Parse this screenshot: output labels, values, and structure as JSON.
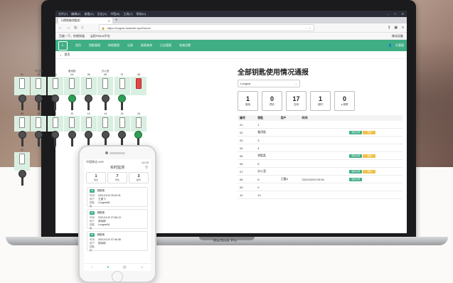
{
  "browser": {
    "menu": [
      "文件(F)",
      "编辑(E)",
      "查看(V)",
      "历史(S)",
      "书签(B)",
      "工具(T)",
      "帮助(H)"
    ],
    "tab_title": "万德智能钥匙柜",
    "url": "https://longest.landwell.vip/#/home",
    "bookmarks": [
      "百度一下，你就知道",
      "云柜PMOA平台"
    ],
    "bookmarks_right": "移动设备"
  },
  "app": {
    "nav": [
      "首页",
      "钥匙管理",
      "授权管理",
      "记录",
      "报表查询",
      "日志管理",
      "系统设置"
    ],
    "user": "天管理",
    "breadcrumb": "首页"
  },
  "keys": {
    "row1_labels": [
      "",
      "车位匙",
      "",
      "备用匙",
      "",
      "办公室",
      ""
    ],
    "row1": [
      {
        "n": "01",
        "k": "dark"
      },
      {
        "n": "02",
        "k": "dark"
      },
      {
        "n": "03",
        "k": "dark"
      },
      {
        "n": "04",
        "k": "green"
      },
      {
        "n": "05",
        "k": "dark"
      },
      {
        "n": "06",
        "k": "dark"
      },
      {
        "n": "07",
        "k": "green"
      },
      {
        "n": "08",
        "k": "none"
      }
    ],
    "row2": [
      {
        "n": "09",
        "k": "dark"
      },
      {
        "n": "10",
        "k": "dark"
      },
      {
        "n": "11",
        "k": "dark"
      },
      {
        "n": "12",
        "k": "dark"
      },
      {
        "n": "13",
        "k": "dark"
      },
      {
        "n": "14",
        "k": "dark"
      },
      {
        "n": "15",
        "k": "dark"
      },
      {
        "n": "16",
        "k": "green"
      }
    ],
    "row3": [
      {
        "n": "17",
        "k": "dark"
      }
    ]
  },
  "panel": {
    "title": "全部钥匙使用情况通报",
    "select": "Longest",
    "stats": [
      {
        "v": "1",
        "l": "借用"
      },
      {
        "v": "0",
        "l": "预约"
      },
      {
        "v": "17",
        "l": "空闲"
      },
      {
        "v": "1",
        "l": "超时"
      },
      {
        "v": "0",
        "l": "● 故障"
      }
    ],
    "headers": [
      "编号",
      "钥匙",
      "用户",
      "时间",
      ""
    ],
    "rows": [
      {
        "id": "01",
        "name": "1",
        "user": "",
        "time": "",
        "a": false,
        "b": false
      },
      {
        "id": "02",
        "name": "备用匙",
        "user": "",
        "time": "",
        "a": true,
        "b": true
      },
      {
        "id": "03",
        "name": "3",
        "user": "",
        "time": "",
        "a": false,
        "b": false
      },
      {
        "id": "04",
        "name": "4",
        "user": "",
        "time": "",
        "a": false,
        "b": false
      },
      {
        "id": "05",
        "name": "钥匙匙",
        "user": "",
        "time": "",
        "a": true,
        "b": true
      },
      {
        "id": "06",
        "name": "6",
        "user": "",
        "time": "",
        "a": false,
        "b": false
      },
      {
        "id": "07",
        "name": "办公室",
        "user": "",
        "time": "",
        "a": true,
        "b": true
      },
      {
        "id": "08",
        "name": "8",
        "user": "王重A",
        "time": "2021/02/09 09:06",
        "a": true,
        "b": false
      },
      {
        "id": "09",
        "name": "9",
        "user": "",
        "time": "",
        "a": false,
        "b": false
      },
      {
        "id": "10",
        "name": "10",
        "user": "",
        "time": "",
        "a": false,
        "b": false
      }
    ],
    "btn_a": "借用记录",
    "btn_b": "预约"
  },
  "phone": {
    "status_left": "中国移动 WiFi",
    "status_right": "12:00",
    "title": "实时监测",
    "stats": [
      {
        "v": "1",
        "l": "借出"
      },
      {
        "v": "7",
        "l": "预约"
      },
      {
        "v": "3",
        "l": "超时"
      }
    ],
    "cards": [
      {
        "tag": "01",
        "title": "钥匙借",
        "time": "2021/11/12 09:02:31",
        "user": "王重飞",
        "key": "Longest36"
      },
      {
        "tag": "02",
        "title": "钥匙借",
        "time": "2021/11/12 07:56:13",
        "user": "张晓明",
        "key": "Longest16"
      },
      {
        "tag": "03",
        "title": "钥匙借",
        "time": "2021/11/12 07:46:38",
        "user": "张晓明",
        "key": ""
      }
    ],
    "card_labels": {
      "time": "时间",
      "user": "用户",
      "key": "钥匙柜"
    }
  },
  "laptop_brand": "MacBook Pro"
}
